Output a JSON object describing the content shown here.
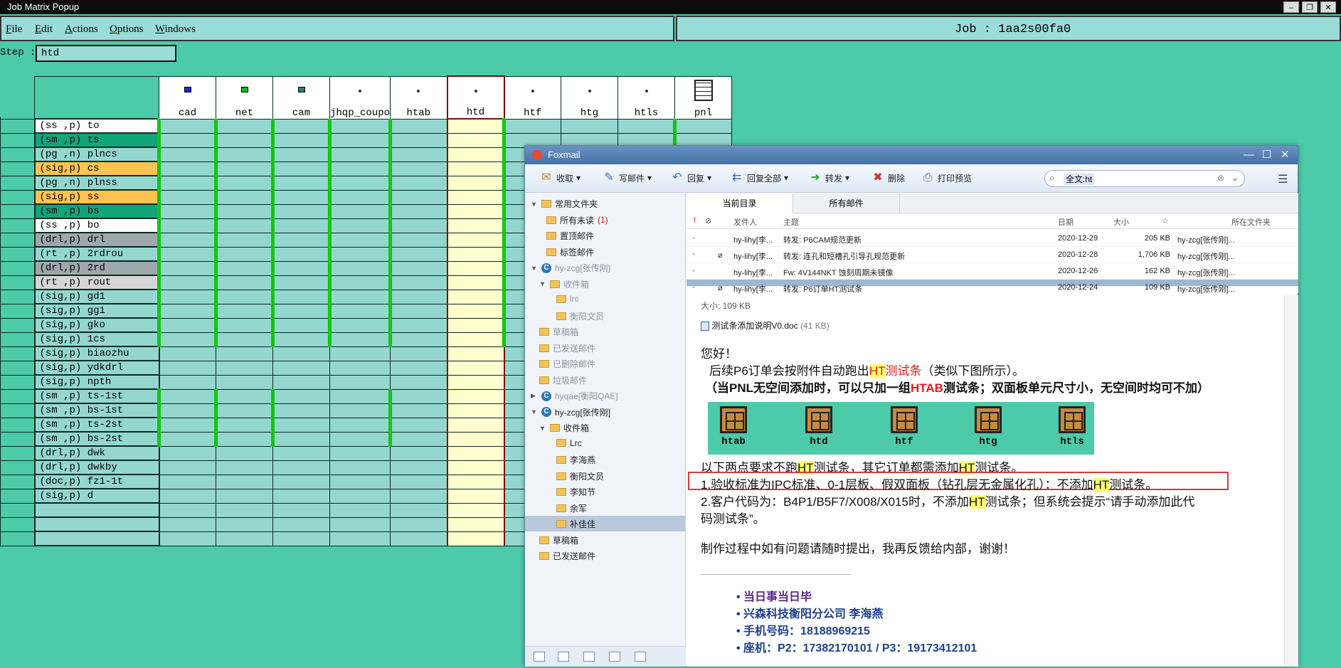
{
  "window": {
    "title": "Job Matrix Popup"
  },
  "menu": [
    "File",
    "Edit",
    "Actions",
    "Options",
    "Windows"
  ],
  "job": {
    "label": "Job : 1aa2s00fa0"
  },
  "step": {
    "label": "Step :",
    "value": "htd"
  },
  "matrix": {
    "columns": [
      {
        "name": "cad",
        "green": true
      },
      {
        "name": "net",
        "green": true
      },
      {
        "name": "cam",
        "green": true
      },
      {
        "name": "jhqp_coupo",
        "green": true
      },
      {
        "name": "htab",
        "green": true
      },
      {
        "name": "htd",
        "green": true,
        "selected": true
      },
      {
        "name": "htf",
        "green": true
      },
      {
        "name": "htg",
        "green": true
      },
      {
        "name": "htls",
        "green": true
      },
      {
        "name": "pnl",
        "green": true
      }
    ],
    "layers": [
      {
        "label": "(ss ,p) to",
        "color": "#ffffff"
      },
      {
        "label": "(sm ,p) ts",
        "color": "#12a57a"
      },
      {
        "label": "(pg ,n) plncs",
        "color": "#93d7cf"
      },
      {
        "label": "(sig,p) cs",
        "color": "#ffc34f"
      },
      {
        "label": "(pg ,n) plnss",
        "color": "#93d7cf"
      },
      {
        "label": "(sig,p) ss",
        "color": "#ffc34f"
      },
      {
        "label": "(sm ,p) bs",
        "color": "#12a57a"
      },
      {
        "label": "(ss ,p) bo",
        "color": "#ffffff"
      },
      {
        "label": "(drl,p) drl",
        "color": "#9ea8aa"
      },
      {
        "label": "(rt ,p) 2rdrou",
        "color": "#93d7cf"
      },
      {
        "label": "(drl,p) 2rd",
        "color": "#9ea8aa"
      },
      {
        "label": "(rt ,p) rout",
        "color": "#d6d6d6"
      },
      {
        "label": "(sig,p) gd1",
        "color": "#93d7cf"
      },
      {
        "label": "(sig,p) gg1",
        "color": "#93d7cf"
      },
      {
        "label": "(sig,p) gko",
        "color": "#93d7cf"
      },
      {
        "label": "(sig,p) 1cs",
        "color": "#93d7cf"
      },
      {
        "label": "(sig,p) biaozhu",
        "color": "#93d7cf"
      },
      {
        "label": "(sig,p) ydkdrl",
        "color": "#93d7cf"
      },
      {
        "label": "(sig,p) npth",
        "color": "#93d7cf"
      },
      {
        "label": "(sm ,p) ts-1st",
        "color": "#93d7cf"
      },
      {
        "label": "(sm ,p) bs-1st",
        "color": "#93d7cf"
      },
      {
        "label": "(sm ,p) ts-2st",
        "color": "#93d7cf"
      },
      {
        "label": "(sm ,p) bs-2st",
        "color": "#93d7cf"
      },
      {
        "label": "(drl,p) dwk",
        "color": "#93d7cf"
      },
      {
        "label": "(drl,p) dwkby",
        "color": "#93d7cf"
      },
      {
        "label": "(doc,p) fz1-1t",
        "color": "#93d7cf"
      },
      {
        "label": "(sig,p) d",
        "color": "#93d7cf"
      },
      {
        "label": "",
        "color": "#93d7cf"
      },
      {
        "label": "",
        "color": "#93d7cf"
      },
      {
        "label": "",
        "color": "#93d7cf"
      }
    ]
  },
  "foxmail": {
    "title": "Foxmail",
    "toolbar": [
      "收取",
      "写邮件",
      "回复",
      "回复全部",
      "转发",
      "删除",
      "打印预览"
    ],
    "search": "全文:ht",
    "folders": [
      {
        "label": "常用文件夹",
        "kind": "group"
      },
      {
        "label": "所有未读",
        "badge": "(1)",
        "kind": "folder"
      },
      {
        "label": "置顶邮件",
        "kind": "folder"
      },
      {
        "label": "标签邮件",
        "kind": "folder"
      },
      {
        "label": "hy-zcg[张传刚]",
        "kind": "account-gray"
      },
      {
        "label": "收件箱",
        "kind": "sub-gray"
      },
      {
        "label": "lrc",
        "kind": "sub2-gray"
      },
      {
        "label": "衡阳文员",
        "kind": "sub2-gray"
      },
      {
        "label": "草稿箱",
        "kind": "sub-gray"
      },
      {
        "label": "已发送邮件",
        "kind": "sub-gray"
      },
      {
        "label": "已删除邮件",
        "kind": "sub-gray"
      },
      {
        "label": "垃圾邮件",
        "kind": "sub-gray"
      },
      {
        "label": "hyqae[衡阳QAE]",
        "kind": "account-gray"
      },
      {
        "label": "hy-zcg[张传刚]",
        "kind": "account"
      },
      {
        "label": "收件箱",
        "kind": "sub"
      },
      {
        "label": "Lrc",
        "kind": "sub2"
      },
      {
        "label": "李海燕",
        "kind": "sub2"
      },
      {
        "label": "衡阳文员",
        "kind": "sub2"
      },
      {
        "label": "李知节",
        "kind": "sub2"
      },
      {
        "label": "余军",
        "kind": "sub2"
      },
      {
        "label": "补佳佳",
        "kind": "sub2"
      },
      {
        "label": "草稿箱",
        "kind": "sub"
      },
      {
        "label": "已发送邮件",
        "kind": "sub"
      }
    ],
    "tabs": [
      "当前目录",
      "所有邮件"
    ],
    "columns": {
      "sender": "发件人",
      "subject": "主题",
      "date": "日期",
      "size": "大小",
      "folder": "所在文件夹"
    },
    "messages": [
      {
        "sender": "hy-lihy[李...",
        "subject": "转发: P6CAM规范更新",
        "date": "2020-12-29",
        "size": "205 KB",
        "folder": "hy-zcg[张传刚]..."
      },
      {
        "sender": "hy-lihy[李...",
        "subject": "转发: 连孔和短槽孔引导孔规范更新",
        "date": "2020-12-28",
        "size": "1,706 KB",
        "folder": "hy-zcg[张传刚]..."
      },
      {
        "sender": "hy-lihy[李...",
        "subject": "Fw: 4V144NKT  蚀刻周期未镜像",
        "date": "2020-12-26",
        "size": "162 KB",
        "folder": "hy-zcg[张传刚]..."
      },
      {
        "sender": "hy-lihy[李...",
        "subject": "转发: P6订单HT测试条",
        "date": "2020-12-24",
        "size": "109 KB",
        "folder": "hy-zcg[张传刚]..."
      }
    ],
    "reading": {
      "size": "大小: 109 KB",
      "attachment": "测试条添加说明V0.doc",
      "attachment_size": "(41 KB)",
      "greeting": "您好！",
      "p1a": "后续P6订单会按附件自动跑出",
      "p1b": "HT",
      "p1c": "测试条",
      "p1d": "（类似下图所示）。",
      "p2a": "（当PNL无空间添加时，可以只加一组",
      "p2b": "HTAB",
      "p2c": "测试条；双面板单元尺寸小，无空间时均可不加）",
      "icons": [
        "htab",
        "htd",
        "htf",
        "htg",
        "htls"
      ],
      "p3a": "以下两点要求不跑",
      "p3b": "HT",
      "p3c": "测试条，其它订单都需添加",
      "p3d": "HT",
      "p3e": "测试条。",
      "p4a": "1.验收标准为IPC标准、0-1层板、假双面板（钻孔层无金属化孔）：不添加",
      "p4b": "HT",
      "p4c": "测试条。",
      "p5a": "2.客户代码为：B4P1/B5F7/X008/X015时，不添加",
      "p5b": "HT",
      "p5c": "测试条；但系统会提示“请手动添加此代",
      "p5d": "码测试条”。",
      "p6": "制作过程中如有问题请随时提出，我再反馈给内部，谢谢！",
      "sig": [
        "当日事当日毕",
        "兴森科技衡阳分公司   李海燕",
        "手机号码：18188969215",
        "座机：P2：17382170101 / P3：19173412101"
      ]
    }
  }
}
